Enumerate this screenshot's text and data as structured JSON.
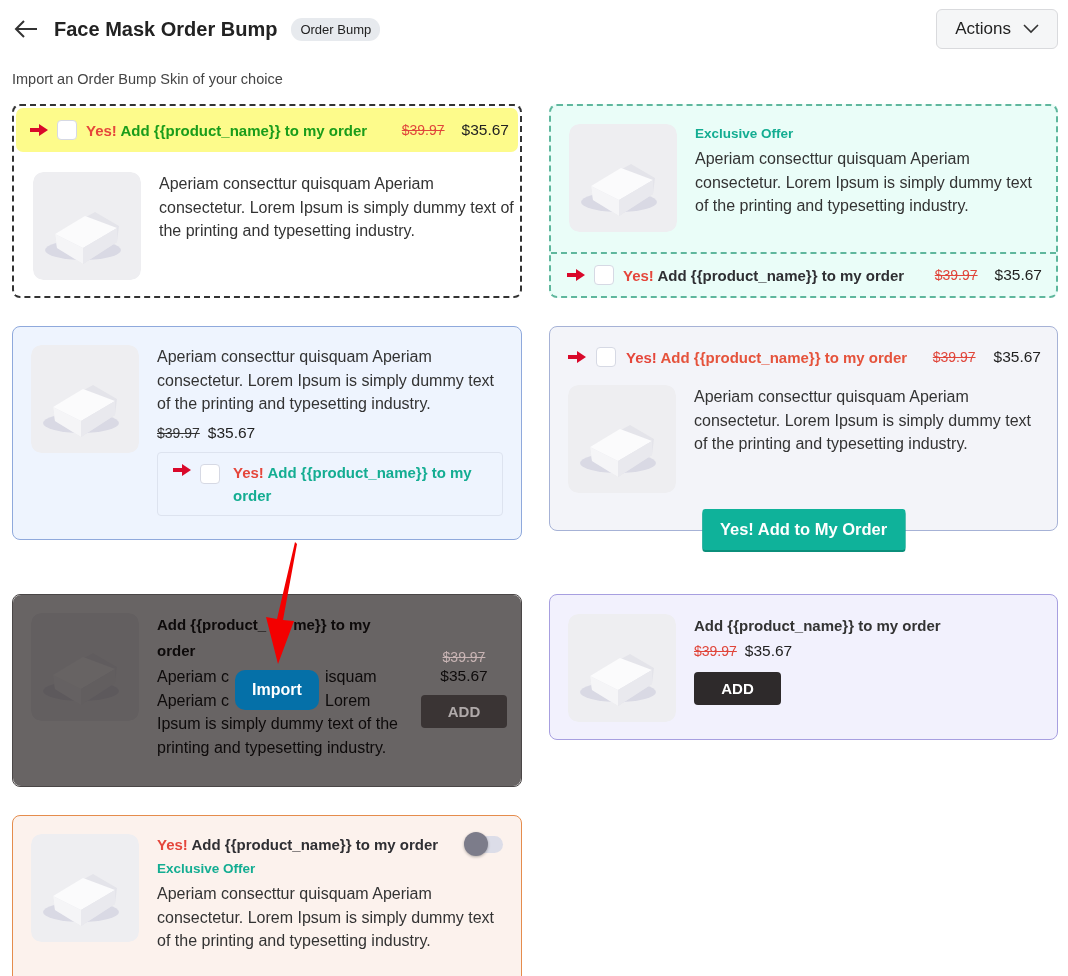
{
  "header": {
    "title": "Face Mask Order Bump",
    "badge": "Order Bump",
    "actions_button": "Actions"
  },
  "subtitle": "Import an Order Bump Skin of your choice",
  "skins": [
    {
      "kind": "bar-top",
      "yes": "Yes!",
      "text": "Add {{product_name}} to my order",
      "checked": false,
      "old_price": "$39.97",
      "price": "$35.67",
      "description": "Aperiam consecttur quisquam Aperiam consectetur. Lorem Ipsum is simply dummy text of the printing and typesetting industry."
    },
    {
      "kind": "bar-bottom",
      "label": "Exclusive Offer",
      "description": "Aperiam consecttur quisquam Aperiam consectetur. Lorem Ipsum is simply dummy text of the printing and typesetting industry.",
      "yes": "Yes!",
      "text": "Add {{product_name}} to my order",
      "checked": false,
      "old_price": "$39.97",
      "price": "$35.67"
    },
    {
      "kind": "inline",
      "description": "Aperiam consecttur quisquam Aperiam consectetur. Lorem Ipsum is simply dummy text of the printing and typesetting industry.",
      "old_price": "$39.97",
      "price": "$35.67",
      "yes": "Yes!",
      "text": "Add {{product_name}} to my order",
      "checked": false
    },
    {
      "kind": "button",
      "yes": "Yes!",
      "text": "Add {{product_name}} to my order",
      "checked": false,
      "old_price": "$39.97",
      "price": "$35.67",
      "description": "Aperiam consecttur quisquam Aperiam consectetur. Lorem Ipsum is simply dummy text of the printing and typesetting industry.",
      "button": "Yes! Add to My Order"
    },
    {
      "kind": "add-side",
      "title_lines": [
        [
          "Add {{product_",
          "me}} to my"
        ],
        [
          "order"
        ]
      ],
      "description_lines": [
        [
          "Aperiam c",
          "isquam"
        ],
        [
          "Aperiam c",
          "Lorem"
        ],
        [
          "Ipsum is simply dummy text of the"
        ],
        [
          "printing and typesetting industry."
        ]
      ],
      "old_price": "$39.97",
      "price": "$35.67",
      "button": "ADD",
      "hovered": true,
      "overlay_button": "Import"
    },
    {
      "kind": "add-compact",
      "title": "Add {{product_name}} to my order",
      "old_price": "$39.97",
      "price": "$35.67",
      "button": "ADD"
    },
    {
      "kind": "toggle",
      "yes": "Yes!",
      "text": "Add {{product_name}} to my order",
      "on": false,
      "label": "Exclusive Offer",
      "description": "Aperiam consecttur quisquam Aperiam consectetur. Lorem Ipsum is simply dummy text of the printing and typesetting industry."
    }
  ]
}
